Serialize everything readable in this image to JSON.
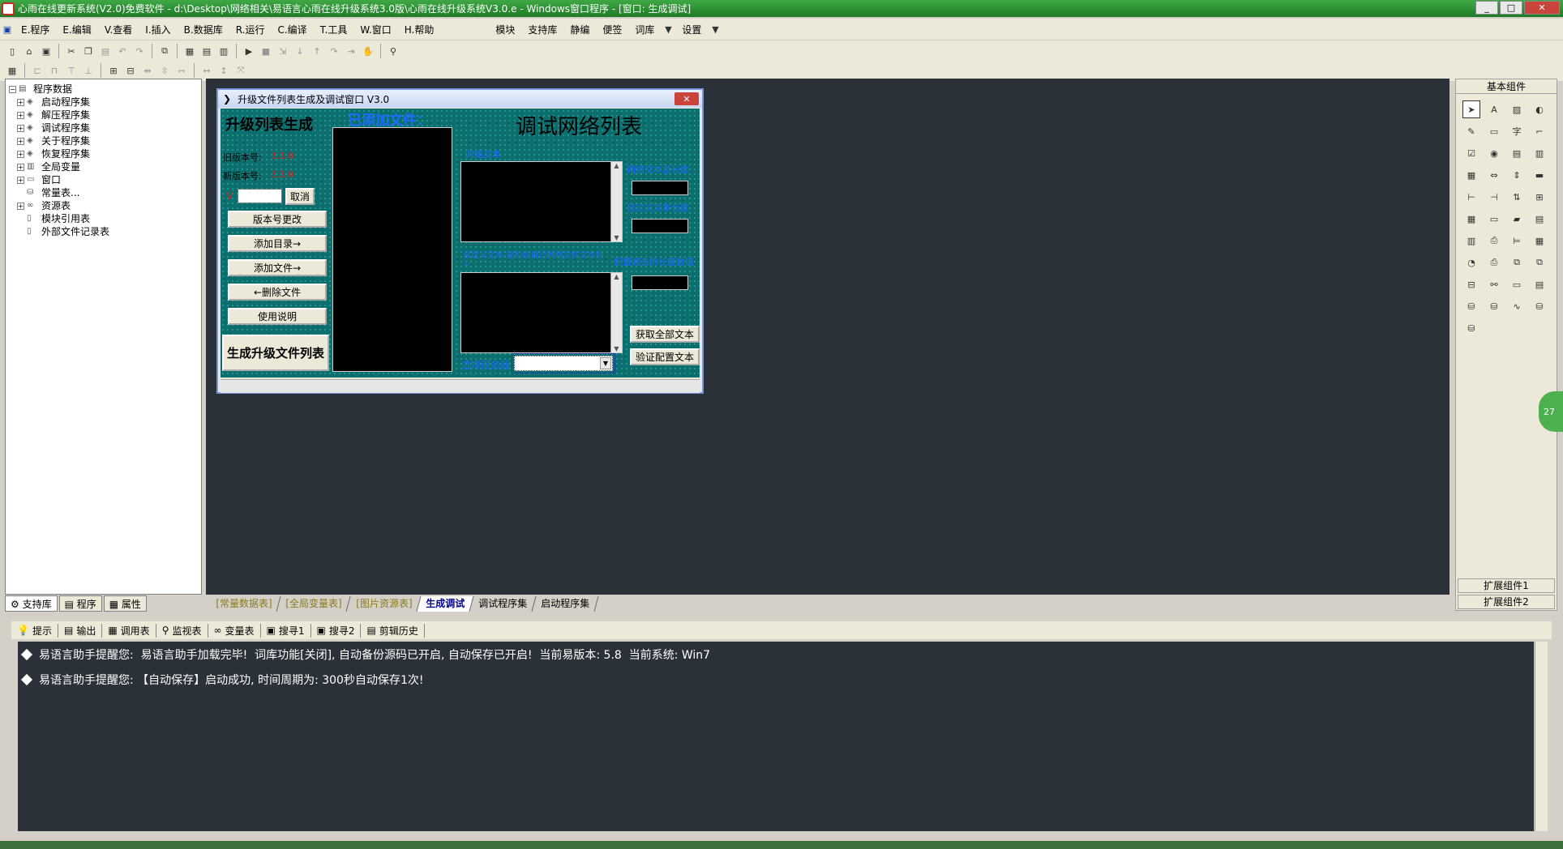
{
  "window": {
    "title": "心雨在线更新系统(V2.0)免费软件 - d:\\Desktop\\网络相关\\易语言心雨在线升级系统3.0版\\心雨在线升级系统V3.0.e - Windows窗口程序 - [窗口: 生成调试]",
    "min": "_",
    "max": "□",
    "close": "✕"
  },
  "menubar": {
    "items": [
      "E.程序",
      "E.编辑",
      "V.查看",
      "I.插入",
      "B.数据库",
      "R.运行",
      "C.编译",
      "T.工具",
      "W.窗口",
      "H.帮助"
    ],
    "extra": [
      "模块",
      "支持库",
      "静编",
      "便签",
      "词库",
      "设置"
    ]
  },
  "left_panel": {
    "tree": [
      {
        "label": "程序数据",
        "root": true
      },
      {
        "label": "启动程序集"
      },
      {
        "label": "解压程序集"
      },
      {
        "label": "调试程序集"
      },
      {
        "label": "关于程序集"
      },
      {
        "label": "恢复程序集"
      },
      {
        "label": "全局变量"
      },
      {
        "label": "窗口"
      },
      {
        "label": "常量表..."
      },
      {
        "label": "资源表"
      },
      {
        "label": "模块引用表",
        "indent": true
      },
      {
        "label": "外部文件记录表",
        "indent": true
      }
    ],
    "tabs": [
      "支持库",
      "程序",
      "属性"
    ]
  },
  "doc_tabs": [
    "[常量数据表]",
    "[全局变量表]",
    "[图片资源表]",
    "生成调试",
    "调试程序集",
    "启动程序集"
  ],
  "designer": {
    "title": "升级文件列表生成及调试窗口 V3.0",
    "heading_left": "升级列表生成",
    "heading_added": "已添加文件：",
    "heading_right": "调试网络列表",
    "old_version_label": "旧版本号:",
    "old_version_value": "3.1.0",
    "new_version_label": "新版本号:",
    "new_version_value": "3.1.0",
    "version_prefix": "V",
    "cancel_button": "取消",
    "buttons": [
      "版本号更改",
      "添加目录→",
      "添加文件→",
      "←删除文件",
      "使用说明"
    ],
    "generate_button": "生成升级文件列表",
    "network_text_label": "网络文本",
    "network_text_total_label": "网络文本总长度",
    "custom_text_length_label": "自定义文本长度",
    "custom_text_label": "自定义文本-复制你自己网络文件文本到↓",
    "config_minus_label": "配置减去的长度数值",
    "get_all_button": "获取全部文本",
    "verify_button": "验证配置文本",
    "server_label": "选择服务器"
  },
  "right_panel": {
    "title": "基本组件",
    "ext1": "扩展组件1",
    "ext2": "扩展组件2",
    "badge": "27"
  },
  "output_tabs": [
    "提示",
    "输出",
    "调用表",
    "监视表",
    "变量表",
    "搜寻1",
    "搜寻2",
    "剪辑历史"
  ],
  "output_lines": [
    "易语言助手提醒您:  易语言助手加载完毕!  词库功能[关闭], 自动备份源码已开启, 自动保存已开启!  当前易版本: 5.8  当前系统: Win7",
    "易语言助手提醒您: 【自动保存】启动成功, 时间周期为: 300秒自动保存1次!"
  ],
  "colors": {
    "titlebar": "#1e7a26",
    "workspace": "#2b3139",
    "form_bg": "#0d6e6e",
    "label_blue": "#1e6bff",
    "value_red": "#d12020"
  }
}
